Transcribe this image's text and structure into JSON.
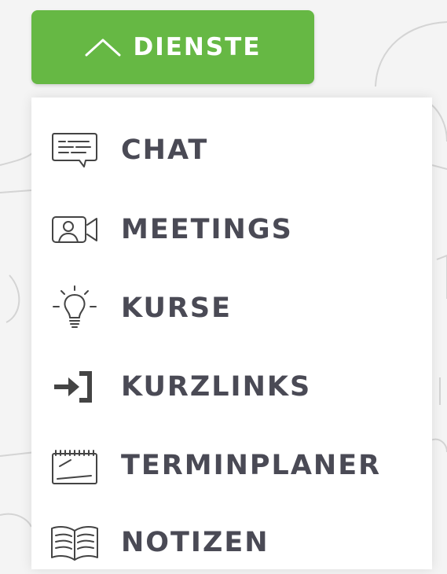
{
  "dienste_button": {
    "label": "DIENSTE",
    "icon": "chevron-up-icon",
    "color": "#66b844"
  },
  "menu": {
    "text_color": "#4a4a55",
    "items": [
      {
        "label": "CHAT",
        "icon": "chat-icon"
      },
      {
        "label": "MEETINGS",
        "icon": "video-meeting-icon"
      },
      {
        "label": "KURSE",
        "icon": "lightbulb-icon"
      },
      {
        "label": "KURZLINKS",
        "icon": "link-arrow-icon"
      },
      {
        "label": "TERMINPLANER",
        "icon": "calendar-icon"
      },
      {
        "label": "NOTIZEN",
        "icon": "book-icon"
      }
    ]
  }
}
